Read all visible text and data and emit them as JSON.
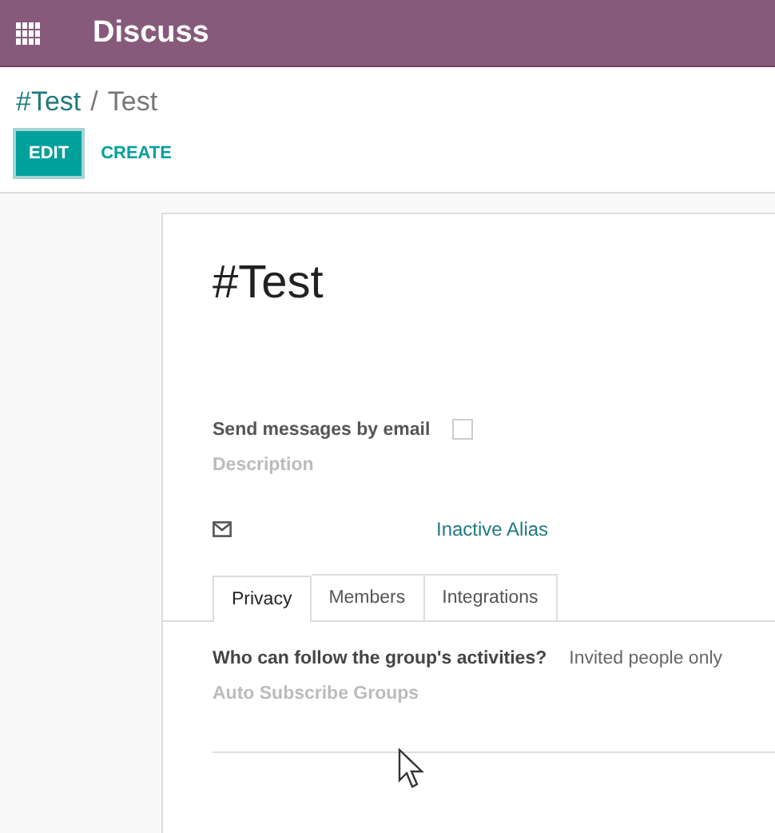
{
  "app_bar": {
    "title": "Discuss"
  },
  "breadcrumb": [
    {
      "label": "#Test",
      "kind": "link"
    },
    {
      "label": "/",
      "kind": "separator"
    },
    {
      "label": "Test",
      "kind": "current"
    }
  ],
  "buttons": [
    {
      "label": "EDIT",
      "kind": "primary"
    },
    {
      "label": "CREATE",
      "kind": "link"
    }
  ],
  "form": {
    "title": "#Test",
    "fields": [
      {
        "label": "Send messages by email",
        "kind": "checkbox",
        "checked": false
      },
      {
        "label": "Description",
        "kind": "empty"
      }
    ],
    "alias": {
      "value": "Inactive Alias"
    },
    "tabs": [
      {
        "label": "Privacy",
        "selected": true
      },
      {
        "label": "Members",
        "selected": false
      },
      {
        "label": "Integrations",
        "selected": false
      }
    ],
    "tab_fields": [
      {
        "label": "Who can follow the group's activities?",
        "kind": "value",
        "value": "Invited people only"
      },
      {
        "label": "Auto Subscribe Groups",
        "kind": "empty"
      }
    ]
  }
}
